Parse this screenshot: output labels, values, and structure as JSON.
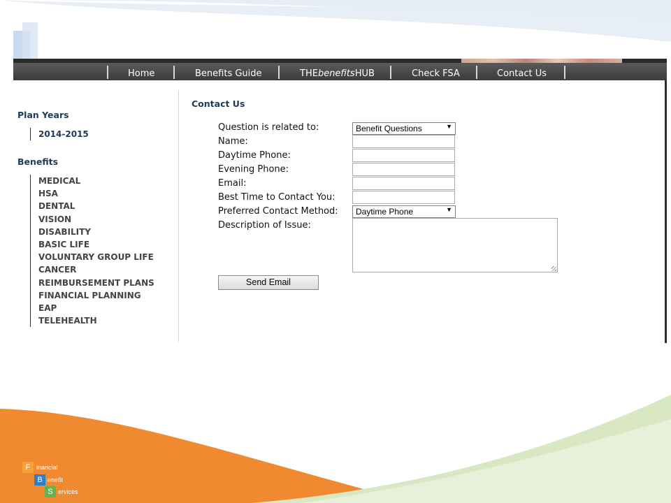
{
  "nav": {
    "items": [
      {
        "label": "Home"
      },
      {
        "label": "Benefits Guide"
      },
      {
        "label_prefix": "THE",
        "label_italic": "benefits",
        "label_suffix": "HUB"
      },
      {
        "label": "Check FSA"
      },
      {
        "label": "Contact Us"
      }
    ]
  },
  "sidebar": {
    "plan_years_heading": "Plan Years",
    "plan_years": [
      "2014-2015"
    ],
    "benefits_heading": "Benefits",
    "benefits": [
      "MEDICAL",
      "HSA",
      "DENTAL",
      "VISION",
      "DISABILITY",
      "BASIC LIFE",
      "VOLUNTARY GROUP LIFE",
      "CANCER",
      "REIMBURSEMENT PLANS",
      "FINANCIAL PLANNING",
      "EAP",
      "TELEHEALTH"
    ]
  },
  "form": {
    "title": "Contact Us",
    "question_label": "Question is related to:",
    "question_value": "Benefit Questions",
    "name_label": "Name:",
    "name_value": "",
    "daytime_phone_label": "Daytime Phone:",
    "daytime_phone_value": "",
    "evening_phone_label": "Evening Phone:",
    "evening_phone_value": "",
    "email_label": "Email:",
    "email_value": "",
    "best_time_label": "Best Time to Contact You:",
    "best_time_value": "",
    "contact_method_label": "Preferred Contact Method:",
    "contact_method_value": "Daytime Phone",
    "description_label": "Description of Issue:",
    "description_value": "",
    "submit_label": "Send Email",
    "dropdown_arrow": "▼"
  },
  "logo": {
    "letters": [
      "F",
      "B",
      "S"
    ],
    "lines": [
      "inancial",
      "enefit",
      "ervices"
    ],
    "colors": {
      "F": "#f4a13a",
      "B": "#2a7fc6",
      "S": "#6ab04c"
    }
  },
  "colors": {
    "nav_bg": "#444444",
    "heading": "#1f3a57",
    "orange_swoosh": "#f08a30",
    "green_swoosh": "#d9e7c2"
  }
}
